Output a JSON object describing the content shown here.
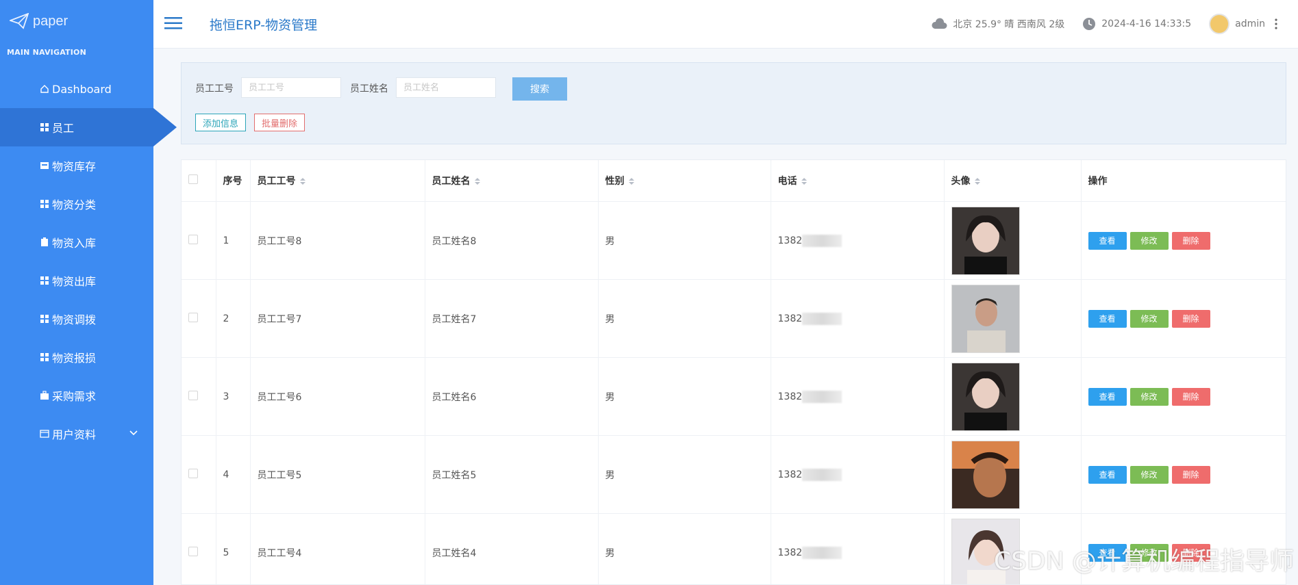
{
  "sidebar": {
    "logo_text": "paper",
    "nav_title": "MAIN NAVIGATION",
    "items": [
      {
        "label": "Dashboard",
        "icon": "home-icon"
      },
      {
        "label": "员工",
        "icon": "grid-icon",
        "active": true
      },
      {
        "label": "物资库存",
        "icon": "box-icon"
      },
      {
        "label": "物资分类",
        "icon": "grid-icon"
      },
      {
        "label": "物资入库",
        "icon": "clipboard-icon"
      },
      {
        "label": "物资出库",
        "icon": "grid-icon"
      },
      {
        "label": "物资调拨",
        "icon": "grid-icon"
      },
      {
        "label": "物资报损",
        "icon": "grid-icon"
      },
      {
        "label": "采购需求",
        "icon": "briefcase-icon"
      },
      {
        "label": "用户资料",
        "icon": "card-icon",
        "expandable": true
      }
    ]
  },
  "header": {
    "title": "拖恒ERP-物资管理",
    "weather": "北京  25.9°  晴  西南风  2级",
    "datetime": "2024-4-16 14:33:5",
    "user": "admin"
  },
  "search": {
    "emp_no_label": "员工工号",
    "emp_no_placeholder": "员工工号",
    "emp_name_label": "员工姓名",
    "emp_name_placeholder": "员工姓名",
    "search_button": "搜索",
    "add_button": "添加信息",
    "batch_delete_button": "批量删除"
  },
  "table": {
    "headers": [
      "序号",
      "员工工号",
      "员工姓名",
      "性别",
      "电话",
      "头像",
      "操作"
    ],
    "rows": [
      {
        "index": "1",
        "emp_no": "员工工号8",
        "emp_name": "员工姓名8",
        "gender": "男",
        "phone": "1382"
      },
      {
        "index": "2",
        "emp_no": "员工工号7",
        "emp_name": "员工姓名7",
        "gender": "男",
        "phone": "1382"
      },
      {
        "index": "3",
        "emp_no": "员工工号6",
        "emp_name": "员工姓名6",
        "gender": "男",
        "phone": "1382"
      },
      {
        "index": "4",
        "emp_no": "员工工号5",
        "emp_name": "员工姓名5",
        "gender": "男",
        "phone": "1382"
      },
      {
        "index": "5",
        "emp_no": "员工工号4",
        "emp_name": "员工姓名4",
        "gender": "男",
        "phone": "1382"
      }
    ],
    "actions": {
      "view": "查看",
      "edit": "修改",
      "delete": "删除"
    }
  },
  "watermark": "CSDN @计算机编程指导师",
  "colors": {
    "sidebar": "#3d8bf2",
    "view": "#2ea0ee",
    "edit": "#7cbc55",
    "delete": "#ef6c6c"
  }
}
